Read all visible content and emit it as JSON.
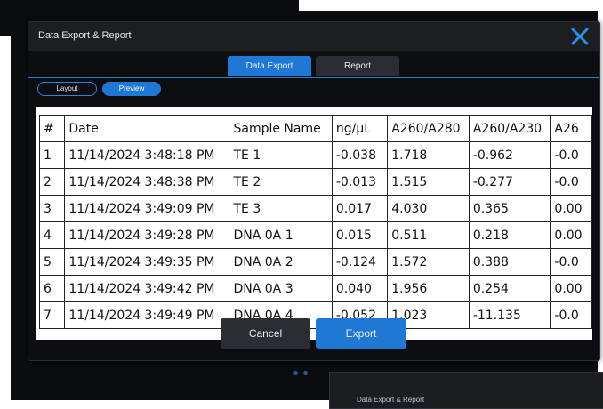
{
  "modal": {
    "title": "Data Export & Report",
    "tabs": [
      {
        "label": "Data Export",
        "active": true
      },
      {
        "label": "Report",
        "active": false
      }
    ],
    "view_toggle": [
      {
        "label": "Layout",
        "selected": false
      },
      {
        "label": "Preview",
        "selected": true
      }
    ],
    "table": {
      "headers": [
        "#",
        "Date",
        "Sample Name",
        "ng/µL",
        "A260/A280",
        "A260/A230",
        "A26"
      ],
      "rows": [
        [
          "1",
          "11/14/2024 3:48:18 PM",
          "TE 1",
          "-0.038",
          "1.718",
          "-0.962",
          "-0.0"
        ],
        [
          "2",
          "11/14/2024 3:48:38 PM",
          "TE 2",
          "-0.013",
          "1.515",
          "-0.277",
          "-0.0"
        ],
        [
          "3",
          "11/14/2024 3:49:09 PM",
          "TE 3",
          "0.017",
          "4.030",
          "0.365",
          "0.00"
        ],
        [
          "4",
          "11/14/2024 3:49:28 PM",
          "DNA 0A 1",
          "0.015",
          "0.511",
          "0.218",
          "0.00"
        ],
        [
          "5",
          "11/14/2024 3:49:35 PM",
          "DNA 0A 2",
          "-0.124",
          "1.572",
          "0.388",
          "-0.0"
        ],
        [
          "6",
          "11/14/2024 3:49:42 PM",
          "DNA 0A 3",
          "0.040",
          "1.956",
          "0.254",
          "0.00"
        ],
        [
          "7",
          "11/14/2024 3:49:49 PM",
          "DNA 0A 4",
          "-0.052",
          "1.023",
          "-11.135",
          "-0.0"
        ]
      ]
    },
    "buttons": {
      "cancel": "Cancel",
      "export": "Export"
    }
  },
  "background_window": {
    "title": "Data Export & Report"
  },
  "colors": {
    "accent": "#1e78d4",
    "modal_bg": "#0d0e11",
    "titlebar": "#1c1e22"
  },
  "icons": {
    "close": "close-icon"
  }
}
